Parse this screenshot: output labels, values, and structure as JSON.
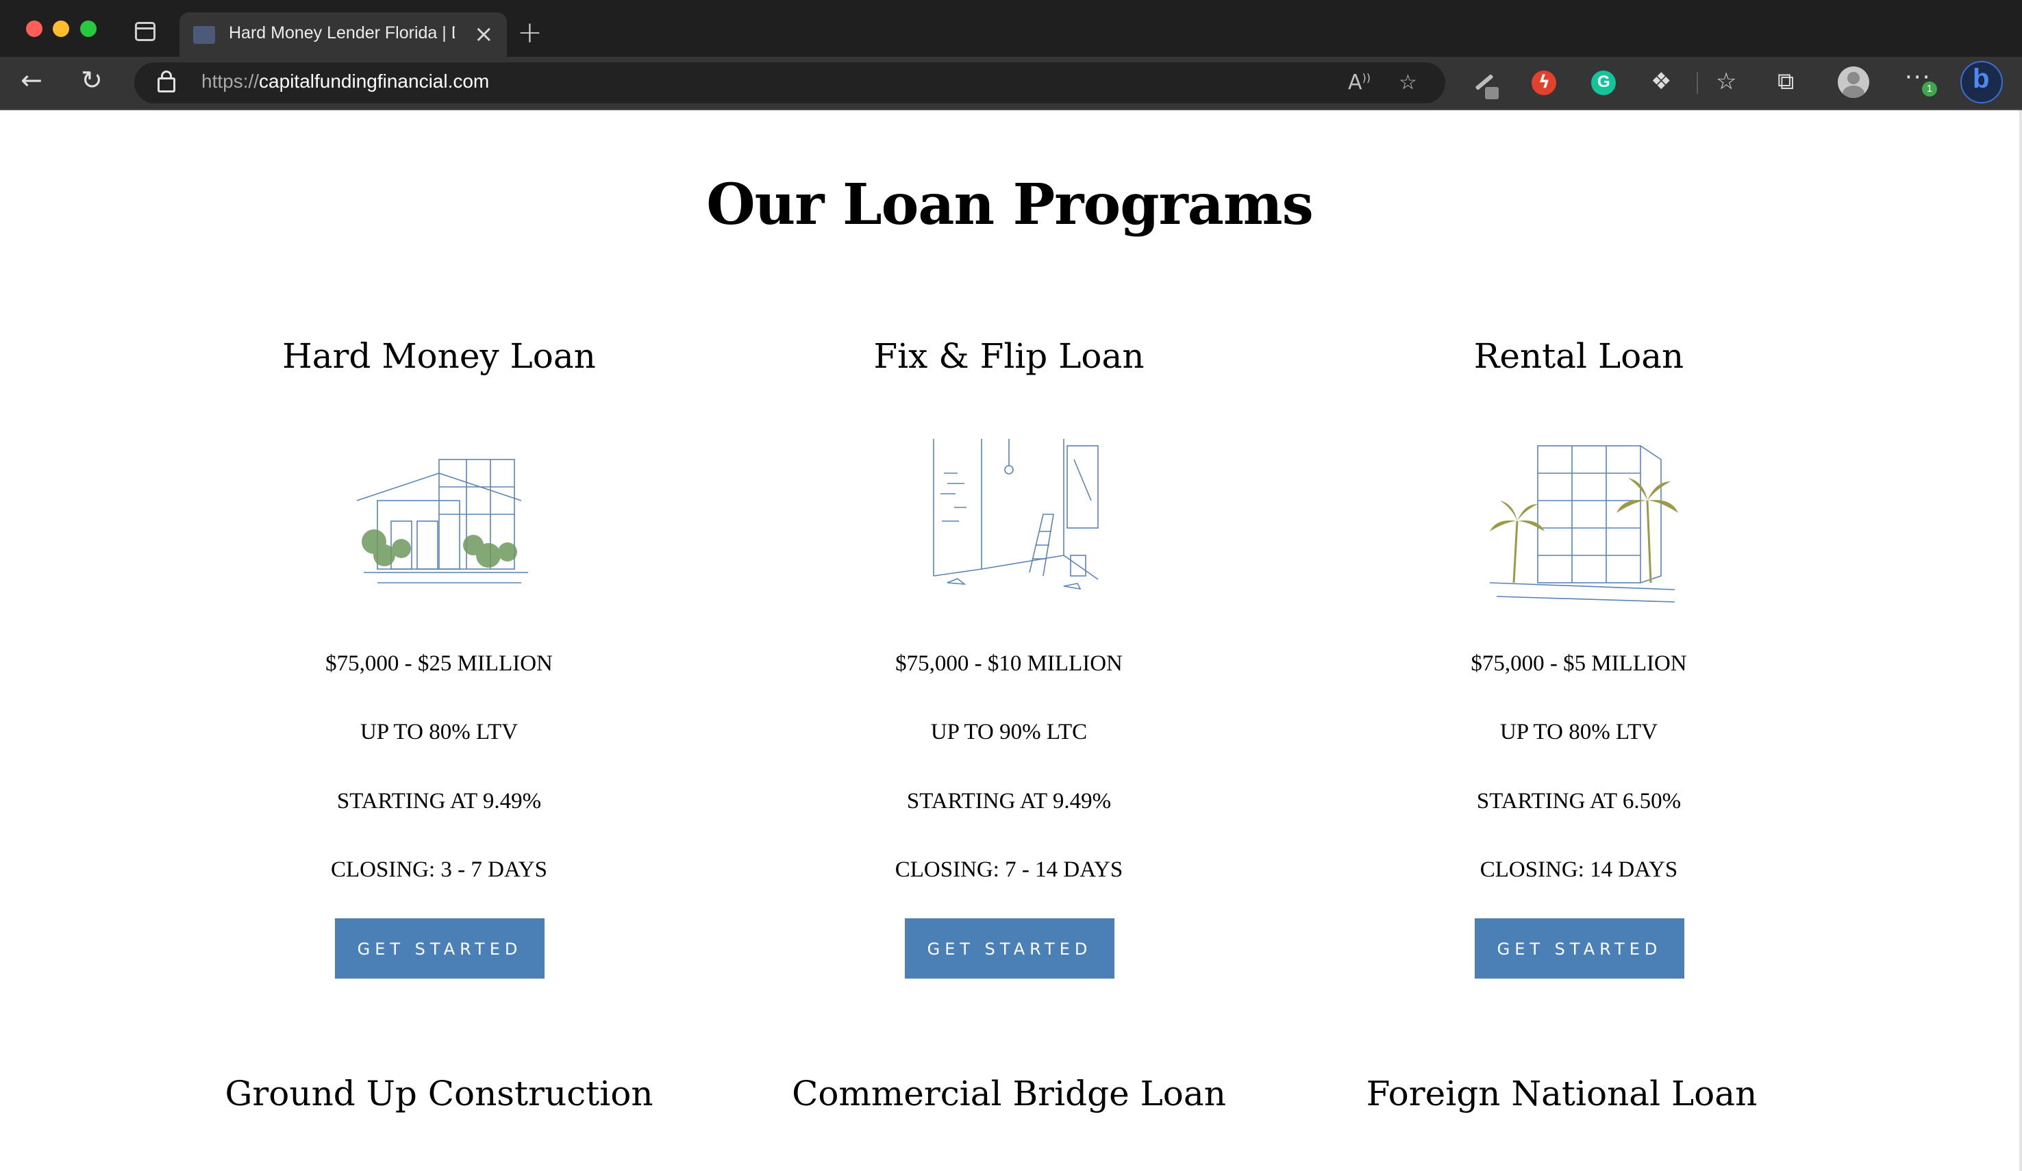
{
  "browser": {
    "tab_title": "Hard Money Lender Florida | Di",
    "url_protocol": "https://",
    "url_host": "capitalfundingfinancial.com",
    "more_badge": "1"
  },
  "main": {
    "heading": "Our Loan Programs",
    "cta_label": "GET STARTED",
    "programs": [
      {
        "title": "Hard Money Loan",
        "amount": "$75,000 - $25 MILLION",
        "ratio": "UP TO 80% LTV",
        "rate": "STARTING AT 9.49%",
        "closing": "CLOSING: 3 - 7 DAYS"
      },
      {
        "title": "Fix & Flip Loan",
        "amount": "$75,000 - $10 MILLION",
        "ratio": "UP TO 90% LTC",
        "rate": "STARTING AT 9.49%",
        "closing": "CLOSING: 7 - 14 DAYS"
      },
      {
        "title": "Rental Loan",
        "amount": "$75,000 - $5 MILLION",
        "ratio": "UP TO 80% LTV",
        "rate": "STARTING AT 6.50%",
        "closing": "CLOSING: 14 DAYS"
      }
    ],
    "more_programs": [
      "Ground Up Construction",
      "Commercial Bridge Loan",
      "Foreign National Loan"
    ]
  },
  "colors": {
    "cta": "#4a80b5",
    "sketch": "#5a84b8",
    "foliage": "#6f9a5e",
    "palm": "#9a9a4a"
  }
}
